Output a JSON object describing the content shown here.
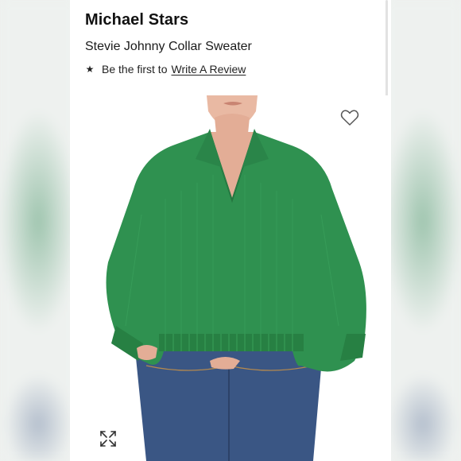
{
  "product": {
    "brand": "Michael Stars",
    "name": "Stevie Johnny Collar Sweater"
  },
  "review": {
    "star_icon": "star-icon",
    "prompt": "Be the first to",
    "link_label": "Write A Review"
  },
  "photo": {
    "subject": "green knit collared sweater with blue jeans",
    "sweater_color": "#2f9150",
    "jeans_color": "#3a5684"
  },
  "actions": {
    "wishlist_icon": "heart-outline-icon",
    "expand_icon": "expand-arrows-icon"
  }
}
